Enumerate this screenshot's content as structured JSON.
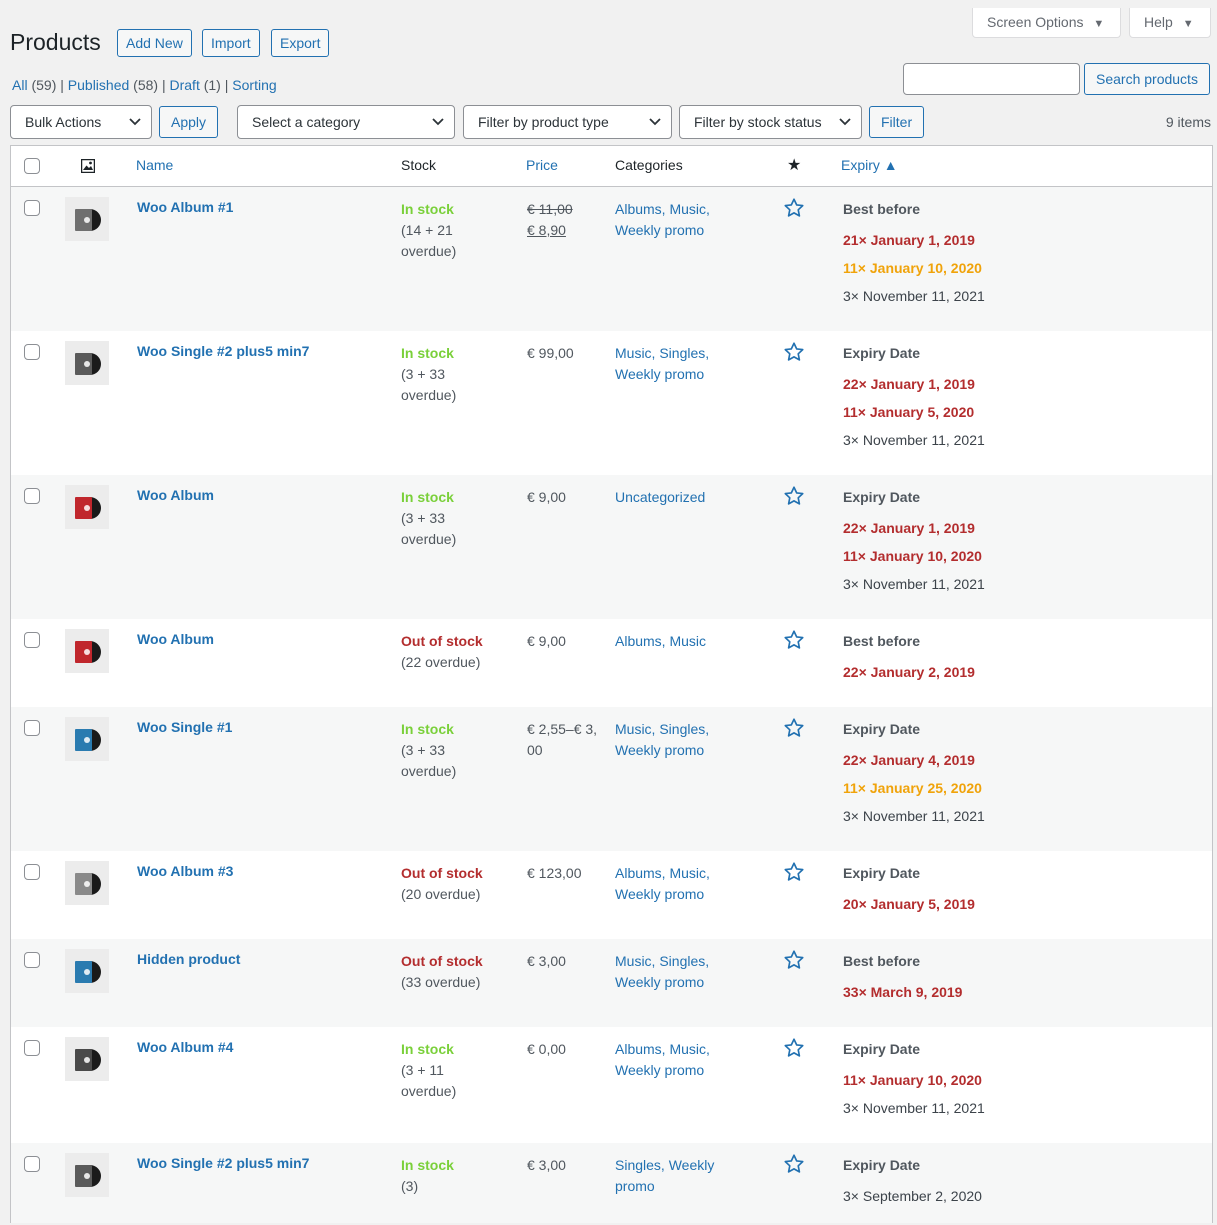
{
  "header": {
    "title": "Products",
    "buttons": {
      "add_new": "Add New",
      "import": "Import",
      "export": "Export"
    },
    "screen_options": "Screen Options",
    "help": "Help"
  },
  "views": {
    "all": "All",
    "all_count": "(59)",
    "published": "Published",
    "published_count": "(58)",
    "draft": "Draft",
    "draft_count": "(1)",
    "sorting": "Sorting"
  },
  "search": {
    "value": "",
    "placeholder": "",
    "button": "Search products"
  },
  "filters": {
    "bulk_actions": "Bulk Actions",
    "apply": "Apply",
    "category": "Select a category",
    "product_type": "Filter by product type",
    "stock_status": "Filter by stock status",
    "filter": "Filter",
    "items_count": "9 items"
  },
  "columns": {
    "name": "Name",
    "stock": "Stock",
    "price": "Price",
    "categories": "Categories",
    "expiry": "Expiry ▲"
  },
  "colors": {
    "link": "#2271b1",
    "in_stock": "#7ad03a",
    "out_stock": "#b32d2e",
    "expired": "#b32d2e",
    "warning": "#f0a30a"
  },
  "rows": [
    {
      "name": "Woo Album #1",
      "thumb_color": "#6f6f6f",
      "stock_status": "In stock",
      "stock_class": "in",
      "stock_detail": "(14 + 21 overdue)",
      "price_regular": "€ 11,00",
      "price_sale": "€ 8,90",
      "price": "",
      "categories": "Albums, Music, Weekly promo",
      "expiry_label": "Best before",
      "expiry_lines": [
        {
          "text": "21× January 1, 2019",
          "type": "red"
        },
        {
          "text": "11× January 10, 2020",
          "type": "orange"
        },
        {
          "text": "3× November 11, 2021",
          "type": "normal"
        }
      ]
    },
    {
      "name": "Woo Single #2 plus5 min7",
      "thumb_color": "#5a5a5a",
      "stock_status": "In stock",
      "stock_class": "in",
      "stock_detail": "(3 + 33 overdue)",
      "price": "€ 99,00",
      "categories": "Music, Singles, Weekly promo",
      "expiry_label": "Expiry Date",
      "expiry_lines": [
        {
          "text": "22× January 1, 2019",
          "type": "red"
        },
        {
          "text": "11× January 5, 2020",
          "type": "red"
        },
        {
          "text": "3× November 11, 2021",
          "type": "normal"
        }
      ]
    },
    {
      "name": "Woo Album",
      "thumb_color": "#c0272d",
      "stock_status": "In stock",
      "stock_class": "in",
      "stock_detail": "(3 + 33 overdue)",
      "price": "€ 9,00",
      "categories": "Uncategorized",
      "expiry_label": "Expiry Date",
      "expiry_lines": [
        {
          "text": "22× January 1, 2019",
          "type": "red"
        },
        {
          "text": "11× January 10, 2020",
          "type": "red"
        },
        {
          "text": "3× November 11, 2021",
          "type": "normal"
        }
      ]
    },
    {
      "name": "Woo Album",
      "thumb_color": "#c0272d",
      "stock_status": "Out of stock",
      "stock_class": "out",
      "stock_detail": "(22 overdue)",
      "price": "€ 9,00",
      "categories": "Albums, Music",
      "expiry_label": "Best before",
      "expiry_lines": [
        {
          "text": "22× January 2, 2019",
          "type": "red"
        }
      ]
    },
    {
      "name": "Woo Single #1",
      "thumb_color": "#2a7bb0",
      "stock_status": "In stock",
      "stock_class": "in",
      "stock_detail": "(3 + 33 overdue)",
      "price": "€ 2,55–€ 3,00",
      "categories": "Music, Singles, Weekly promo",
      "expiry_label": "Expiry Date",
      "expiry_lines": [
        {
          "text": "22× January 4, 2019",
          "type": "red"
        },
        {
          "text": "11× January 25, 2020",
          "type": "orange"
        },
        {
          "text": "3× November 11, 2021",
          "type": "normal"
        }
      ]
    },
    {
      "name": "Woo Album #3",
      "thumb_color": "#8a8a8a",
      "stock_status": "Out of stock",
      "stock_class": "out",
      "stock_detail": "(20 overdue)",
      "price": "€ 123,00",
      "categories": "Albums, Music, Weekly promo",
      "expiry_label": "Expiry Date",
      "expiry_lines": [
        {
          "text": "20× January 5, 2019",
          "type": "red"
        }
      ]
    },
    {
      "name": "Hidden product",
      "thumb_color": "#2a7bb0",
      "stock_status": "Out of stock",
      "stock_class": "out",
      "stock_detail": "(33 overdue)",
      "price": "€ 3,00",
      "categories": "Music, Singles, Weekly promo",
      "expiry_label": "Best before",
      "expiry_lines": [
        {
          "text": "33× March 9, 2019",
          "type": "red"
        }
      ]
    },
    {
      "name": "Woo Album #4",
      "thumb_color": "#4a4a4a",
      "stock_status": "In stock",
      "stock_class": "in",
      "stock_detail": "(3 + 11 overdue)",
      "price": "€ 0,00",
      "categories": "Albums, Music, Weekly promo",
      "expiry_label": "Expiry Date",
      "expiry_lines": [
        {
          "text": "11× January 10, 2020",
          "type": "red"
        },
        {
          "text": "3× November 11, 2021",
          "type": "normal"
        }
      ]
    },
    {
      "name": "Woo Single #2 plus5 min7",
      "thumb_color": "#5a5a5a",
      "stock_status": "In stock",
      "stock_class": "in",
      "stock_detail": "(3)",
      "price": "€ 3,00",
      "categories": "Singles, Weekly promo",
      "expiry_label": "Expiry Date",
      "expiry_lines": [
        {
          "text": "3× September 2, 2020",
          "type": "normal"
        }
      ]
    }
  ]
}
